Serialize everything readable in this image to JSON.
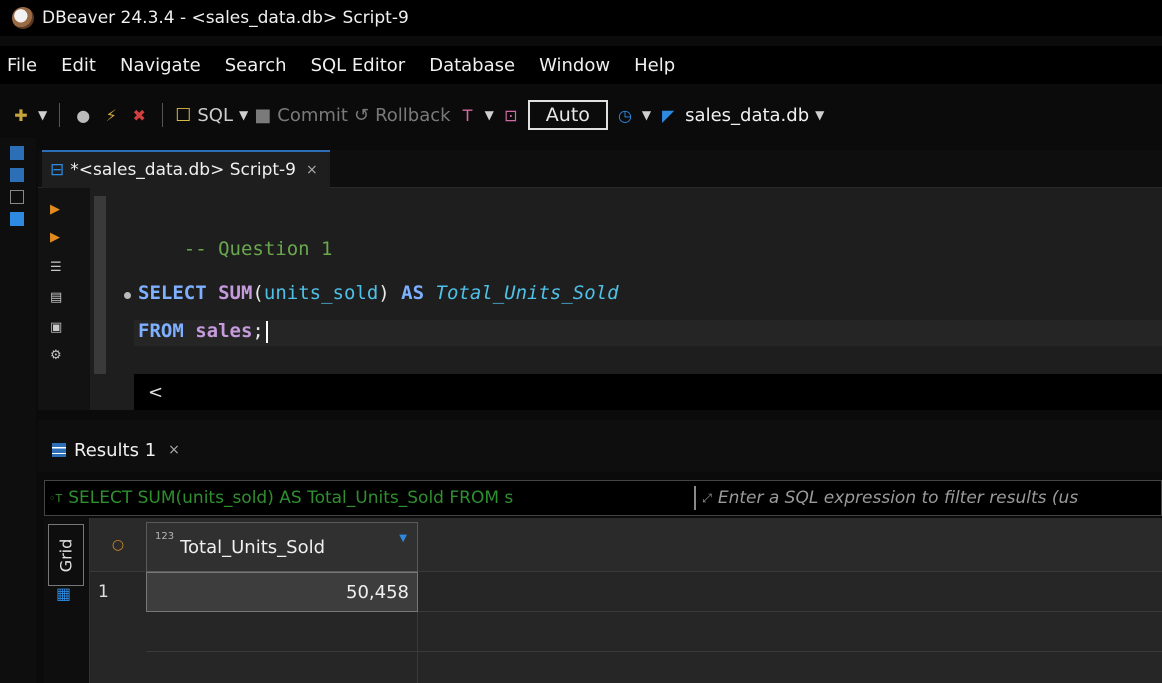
{
  "window": {
    "title": "DBeaver 24.3.4 - <sales_data.db> Script-9"
  },
  "menu": [
    "File",
    "Edit",
    "Navigate",
    "Search",
    "SQL Editor",
    "Database",
    "Window",
    "Help"
  ],
  "toolbar": {
    "sql_label": "SQL",
    "commit_label": "Commit",
    "rollback_label": "Rollback",
    "auto_label": "Auto",
    "database": "sales_data.db"
  },
  "editor_tab": {
    "label": "*<sales_data.db> Script-9",
    "close": "×"
  },
  "code": {
    "comment": "-- Question 1",
    "select_kw": "SELECT",
    "sum_fn": "SUM",
    "paren_open": "(",
    "column": "units_sold",
    "paren_close": ")",
    "as_kw": "AS",
    "alias": "Total_Units_Sold",
    "from_kw": "FROM",
    "table": "sales",
    "semicolon": ";"
  },
  "scroll_left": "<",
  "results_tab": {
    "label": "Results 1",
    "close": "×"
  },
  "filter": {
    "query": "SELECT SUM(units_sold) AS Total_Units_Sold FROM s",
    "placeholder": "Enter a SQL expression to filter results (us"
  },
  "grid": {
    "side_label": "Grid",
    "columns": [
      {
        "type_badge": "123",
        "name": "Total_Units_Sold"
      }
    ],
    "rows": [
      {
        "num": "1",
        "values": [
          "50,458"
        ]
      }
    ]
  },
  "colors": {
    "accent": "#2d6fb7",
    "comment": "#6aa84f",
    "keyword": "#7fb0ff",
    "identifier": "#4fc1e9"
  }
}
